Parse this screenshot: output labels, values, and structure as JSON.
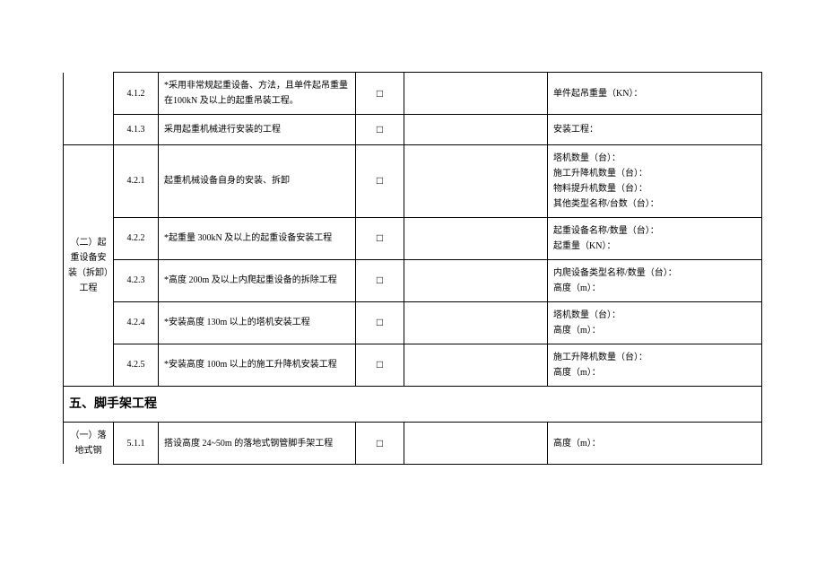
{
  "checkbox_glyph": "□",
  "section4_category_blank": "",
  "rows_upper": [
    {
      "num": "4.1.2",
      "desc": "*采用非常规起重设备、方法，且单件起吊重量在100kN 及以上的起重吊装工程。",
      "notes": "单件起吊重量（KN）："
    },
    {
      "num": "4.1.3",
      "desc": "采用起重机械进行安装的工程",
      "notes": "安装工程："
    }
  ],
  "section4_category_2": "（二）起重设备安装（拆卸）工程",
  "rows_4_2": [
    {
      "num": "4.2.1",
      "desc": "起重机械设备自身的安装、拆卸",
      "notes": "塔机数量（台）：\n施工升降机数量（台）：\n物料提升机数量（台）：\n其他类型名称/台数（台）："
    },
    {
      "num": "4.2.2",
      "desc": "*起重量 300kN 及以上的起重设备安装工程",
      "notes": "起重设备名称/数量（台）：\n起重量（KN）："
    },
    {
      "num": "4.2.3",
      "desc": "*高度 200m 及以上内爬起重设备的拆除工程",
      "notes": "内爬设备类型名称/数量（台）：\n高度（m）："
    },
    {
      "num": "4.2.4",
      "desc": "*安装高度 130m 以上的塔机安装工程",
      "notes": "塔机数量（台）：\n高度（m）："
    },
    {
      "num": "4.2.5",
      "desc": "*安装高度 100m 以上的施工升降机安装工程",
      "notes": "施工升降机数量（台）：\n高度（m）："
    }
  ],
  "section5_heading": "五、脚手架工程",
  "section5_category_1": "（一）落地式钢",
  "rows_5": [
    {
      "num": "5.1.1",
      "desc": "搭设高度 24~50m 的落地式钢管脚手架工程",
      "notes": "高度（m）："
    }
  ]
}
